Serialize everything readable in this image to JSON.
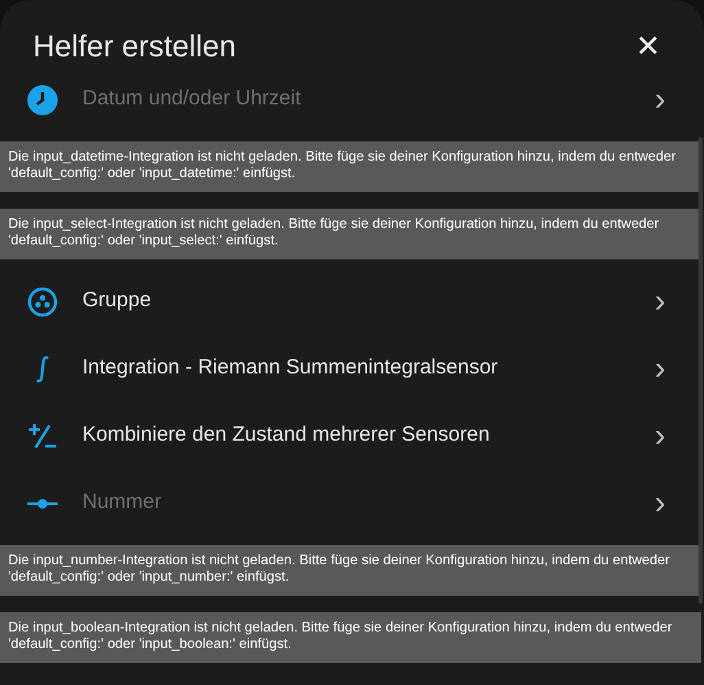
{
  "dialog": {
    "title": "Helfer erstellen",
    "close": "✕"
  },
  "items": [
    {
      "kind": "row",
      "label": "Datum und/oder Uhrzeit",
      "disabled": true,
      "chevron": "›"
    },
    {
      "kind": "notice",
      "text": "Die input_datetime-Integration ist nicht geladen. Bitte füge sie deiner Konfiguration hinzu, indem du entweder 'default_config:' oder 'input_datetime:' einfügst."
    },
    {
      "kind": "notice",
      "text": "Die input_select-Integration ist nicht geladen. Bitte füge sie deiner Konfiguration hinzu, indem du entweder 'default_config:' oder 'input_select:' einfügst."
    },
    {
      "kind": "row",
      "label": "Gruppe",
      "disabled": false,
      "chevron": "›"
    },
    {
      "kind": "row",
      "label": "Integration - Riemann Summenintegralsensor",
      "disabled": false,
      "chevron": "›"
    },
    {
      "kind": "row",
      "label": "Kombiniere den Zustand mehrerer Sensoren",
      "disabled": false,
      "chevron": "›"
    },
    {
      "kind": "row",
      "label": "Nummer",
      "disabled": true,
      "chevron": "›"
    },
    {
      "kind": "notice",
      "text": "Die input_number-Integration ist nicht geladen. Bitte füge sie deiner Konfiguration hinzu, indem du entweder 'default_config:' oder 'input_number:' einfügst."
    },
    {
      "kind": "notice",
      "text": "Die input_boolean-Integration ist nicht geladen. Bitte füge sie deiner Konfiguration hinzu, indem du entweder 'default_config:' oder 'input_boolean:' einfügst."
    }
  ]
}
